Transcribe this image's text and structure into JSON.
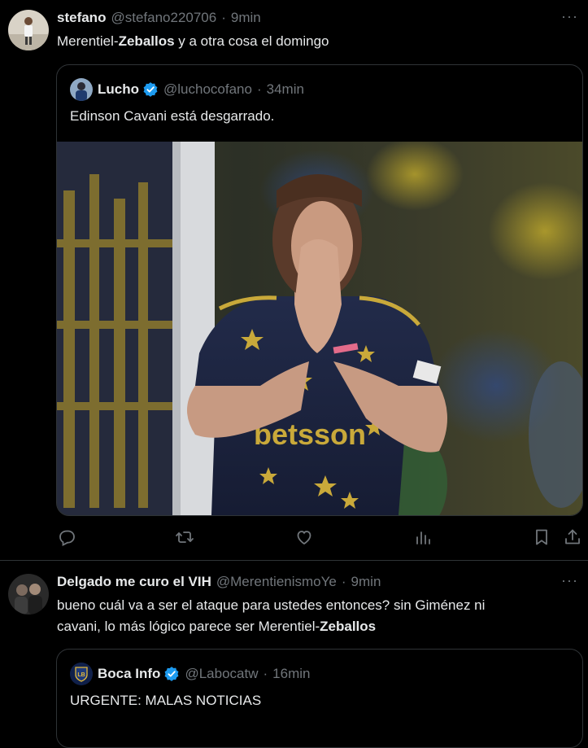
{
  "tweet1": {
    "name": "stefano",
    "handle": "@stefano220706",
    "sep": "·",
    "time": "9min",
    "text_before": "Merentiel-",
    "text_bold": "Zeballos",
    "text_after": " y a otra cosa el domingo",
    "more": "···",
    "quote": {
      "name": "Lucho",
      "handle": "@luchocofano",
      "sep": "·",
      "time": "34min",
      "text": "Edinson Cavani está desgarrado.",
      "image_sponsor": "betsson"
    }
  },
  "tweet2": {
    "name": "Delgado me curo el VIH",
    "handle": "@MerentienismoYe",
    "sep": "·",
    "time": "9min",
    "text_line1": "bueno cuál va a ser el ataque para ustedes entonces? sin Giménez ni",
    "text_line2_before": "cavani, lo más lógico parece ser Merentiel-",
    "text_line2_bold": "Zeballos",
    "more": "···",
    "quote": {
      "name": "Boca Info",
      "handle": "@Labocatw",
      "sep": "·",
      "time": "16min",
      "avatar_text": "LB",
      "text": "URGENTE: MALAS NOTICIAS"
    }
  },
  "colors": {
    "background": "#000000",
    "text": "#e7e9ea",
    "secondary": "#71767b",
    "border": "#2f3336",
    "verified": "#1d9bf0"
  },
  "icons": [
    "reply-icon",
    "retweet-icon",
    "like-icon",
    "views-icon",
    "bookmark-icon",
    "share-icon",
    "verified-icon",
    "more-icon"
  ]
}
